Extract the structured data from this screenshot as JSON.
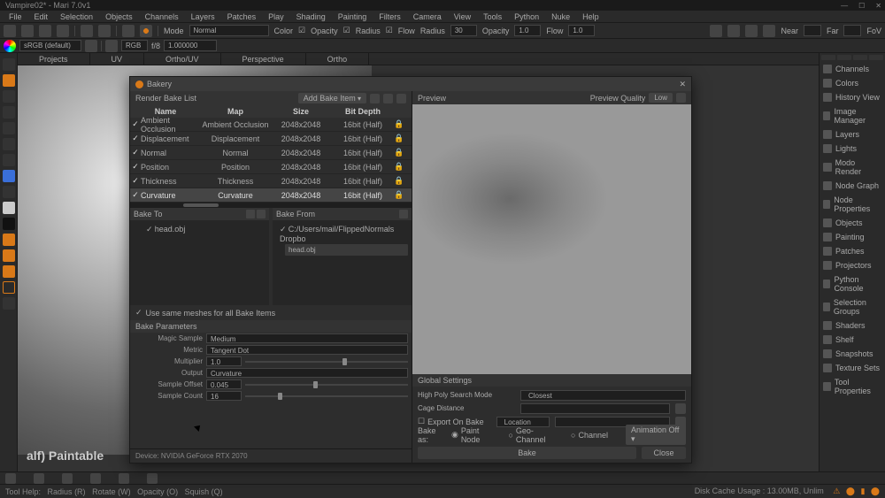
{
  "app": {
    "title": "Vampire02* - Mari 7.0v1"
  },
  "menu": [
    "File",
    "Edit",
    "Selection",
    "Objects",
    "Channels",
    "Layers",
    "Patches",
    "Play",
    "Shading",
    "Painting",
    "Filters",
    "Camera",
    "View",
    "Tools",
    "Python",
    "Nuke",
    "Help"
  ],
  "toolbar1": {
    "mode_label": "Mode",
    "mode_value": "Normal",
    "color_label": "Color",
    "opacity_label": "Opacity",
    "radius_label": "Radius",
    "flow_label": "Flow",
    "radius2_label": "Radius",
    "radius2_value": "30",
    "opacity2_label": "Opacity",
    "opacity2_value": "1.0",
    "flow2_label": "Flow",
    "flow2_value": "1.0",
    "near_label": "Near",
    "far_label": "Far",
    "fov_label": "FoV"
  },
  "toolbar2": {
    "profile": "sRGB (default)",
    "space": "RGB",
    "fstop_label": "f/8",
    "value": "1.000000"
  },
  "viewport_tabs": [
    "Projects",
    "UV",
    "Ortho/UV",
    "Perspective",
    "Ortho"
  ],
  "viewport_overlay": "alf) Paintable",
  "node_props": "Node Properties",
  "right_panel": [
    "Channels",
    "Colors",
    "History View",
    "Image Manager",
    "Layers",
    "Lights",
    "Modo Render",
    "Node Graph",
    "Node Properties",
    "Objects",
    "Painting",
    "Patches",
    "Projectors",
    "Python Console",
    "Selection Groups",
    "Shaders",
    "Shelf",
    "Snapshots",
    "Texture Sets",
    "Tool Properties"
  ],
  "dialog": {
    "title": "Bakery",
    "render_list": "Render Bake List",
    "add_bake": "Add Bake Item",
    "cols": {
      "name": "Name",
      "map": "Map",
      "size": "Size",
      "depth": "Bit Depth"
    },
    "rows": [
      {
        "name": "Ambient Occlusion",
        "map": "Ambient Occlusion",
        "size": "2048x2048",
        "depth": "16bit (Half)"
      },
      {
        "name": "Displacement",
        "map": "Displacement",
        "size": "2048x2048",
        "depth": "16bit (Half)"
      },
      {
        "name": "Normal",
        "map": "Normal",
        "size": "2048x2048",
        "depth": "16bit (Half)"
      },
      {
        "name": "Position",
        "map": "Position",
        "size": "2048x2048",
        "depth": "16bit (Half)"
      },
      {
        "name": "Thickness",
        "map": "Thickness",
        "size": "2048x2048",
        "depth": "16bit (Half)"
      },
      {
        "name": "Curvature",
        "map": "Curvature",
        "size": "2048x2048",
        "depth": "16bit (Half)"
      }
    ],
    "bake_to": "Bake To",
    "bake_from": "Bake From",
    "to_items": [
      "head.obj"
    ],
    "from_path": "C:/Users/mail/FlippedNormals Dropbo",
    "from_file": "head.obj",
    "use_same": "Use same meshes for all Bake Items",
    "params_hdr": "Bake Parameters",
    "params": {
      "magic_sample_lbl": "Magic Sample",
      "magic_sample": "Medium",
      "metric_lbl": "Metric",
      "metric": "Tangent Dot",
      "multiplier_lbl": "Multiplier",
      "multiplier": "1.0",
      "output_lbl": "Output",
      "output": "Curvature",
      "sample_offset_lbl": "Sample Offset",
      "sample_offset": "0.045",
      "sample_count_lbl": "Sample Count",
      "sample_count": "16"
    },
    "device": "Device: NVIDIA GeForce RTX 2070",
    "preview": "Preview",
    "preview_quality_lbl": "Preview Quality",
    "preview_quality": "Low",
    "global_hdr": "Global Settings",
    "global": {
      "search_mode_lbl": "High Poly Search Mode",
      "search_mode": "Closest",
      "cage_lbl": "Cage Distance",
      "export_lbl": "Export On Bake",
      "export_mode": "Location",
      "bake_as_lbl": "Bake as:",
      "paint_node": "Paint Node",
      "geo_channel": "Geo-Channel",
      "channel": "Channel",
      "anim_lbl": "Animation Off"
    },
    "bake_btn": "Bake",
    "close_btn": "Close"
  },
  "status": {
    "help": "Tool Help:",
    "radius": "Radius (R)",
    "rotate": "Rotate (W)",
    "opacity": "Opacity (O)",
    "squish": "Squish (Q)",
    "disk": "Disk Cache Usage : 13.00MB, Unlim"
  }
}
